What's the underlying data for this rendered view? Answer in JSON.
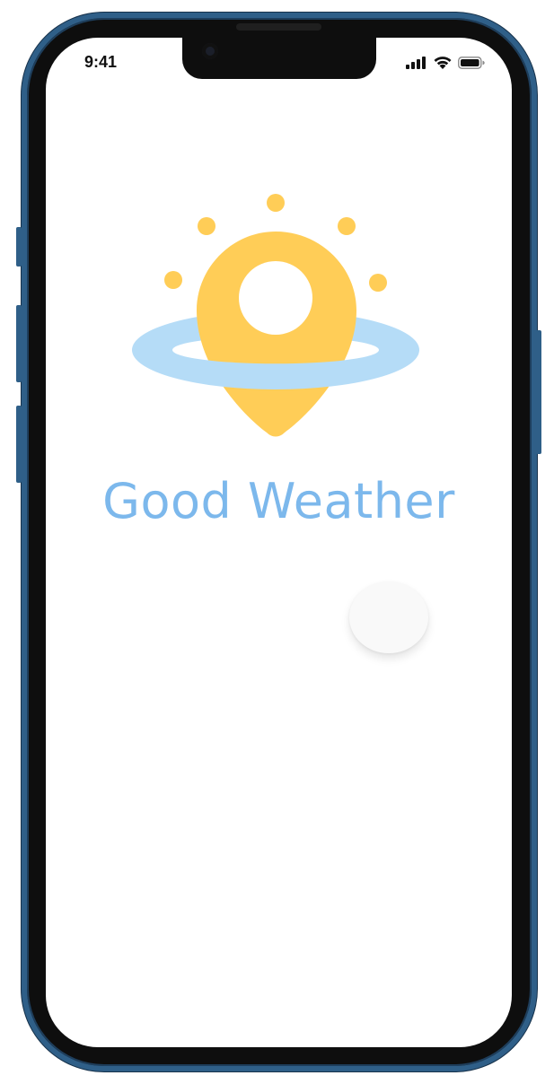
{
  "status_bar": {
    "time": "9:41",
    "icons": [
      "cellular-signal-icon",
      "wifi-icon",
      "battery-icon"
    ]
  },
  "app": {
    "title": "Good Weather",
    "logo": "sun-location-pin-logo",
    "colors": {
      "title": "#7cb8ec",
      "sun": "#ffcd57",
      "ring": "#b5dcf7",
      "device_frame": "#2f5f88"
    }
  },
  "loader": {
    "icon": "loading-indicator"
  }
}
